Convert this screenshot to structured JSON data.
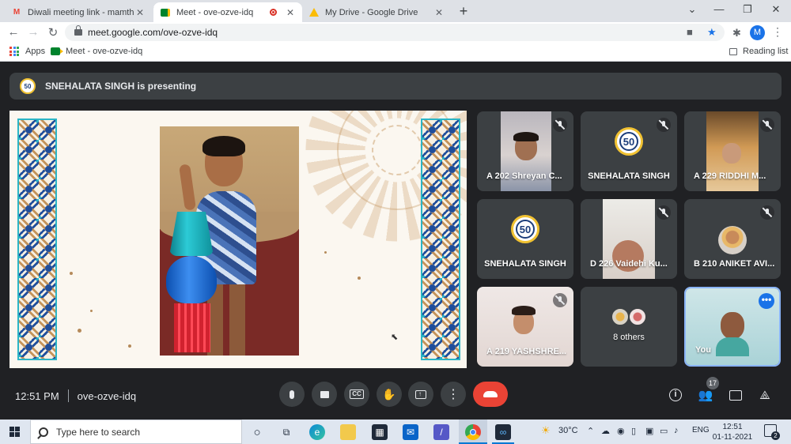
{
  "browser": {
    "tabs": [
      {
        "title": "Diwali meeting link - mamthared",
        "favicon": "gmail-icon",
        "active": false
      },
      {
        "title": "Meet - ove-ozve-idq",
        "favicon": "meet-icon",
        "active": true,
        "recording": true
      },
      {
        "title": "My Drive - Google Drive",
        "favicon": "drive-icon",
        "active": false
      }
    ],
    "new_tab": "+",
    "url": "meet.google.com/ove-ozve-idq",
    "profile_initial": "M",
    "bookmarks": {
      "apps": "Apps",
      "meet": "Meet - ove-ozve-idq",
      "reading_list": "Reading list"
    }
  },
  "meet": {
    "presenter_banner": "SNEHALATA SINGH is presenting",
    "logo_text": "50",
    "participants": [
      {
        "name": "A 202 Shreyan C...",
        "type": "video",
        "muted": true
      },
      {
        "name": "SNEHALATA SINGH",
        "type": "logo",
        "muted": true
      },
      {
        "name": "A 229 RIDDHI M...",
        "type": "video",
        "muted": true
      },
      {
        "name": "SNEHALATA SINGH",
        "type": "logo",
        "muted": false
      },
      {
        "name": "D 226 Vaidehi Ku...",
        "type": "video",
        "muted": true
      },
      {
        "name": "B 210 ANIKET AVI...",
        "type": "avatar",
        "muted": true
      },
      {
        "name": "A 219 YASHSHRE...",
        "type": "video",
        "muted": true
      },
      {
        "name": "8 others",
        "type": "others",
        "muted": false
      },
      {
        "name": "You",
        "type": "video-self",
        "muted": false
      }
    ],
    "more_options": "•••",
    "time": "12:51 PM",
    "meeting_code": "ove-ozve-idq",
    "people_count": "17"
  },
  "taskbar": {
    "search_placeholder": "Type here to search",
    "weather": "30°C",
    "language": "ENG",
    "time": "12:51",
    "date": "01-11-2021",
    "notification_count": "2"
  },
  "colors": {
    "end_call": "#ea4335",
    "accent": "#1a73e8",
    "meet_bg": "#202124",
    "tile_bg": "#3c4043"
  }
}
